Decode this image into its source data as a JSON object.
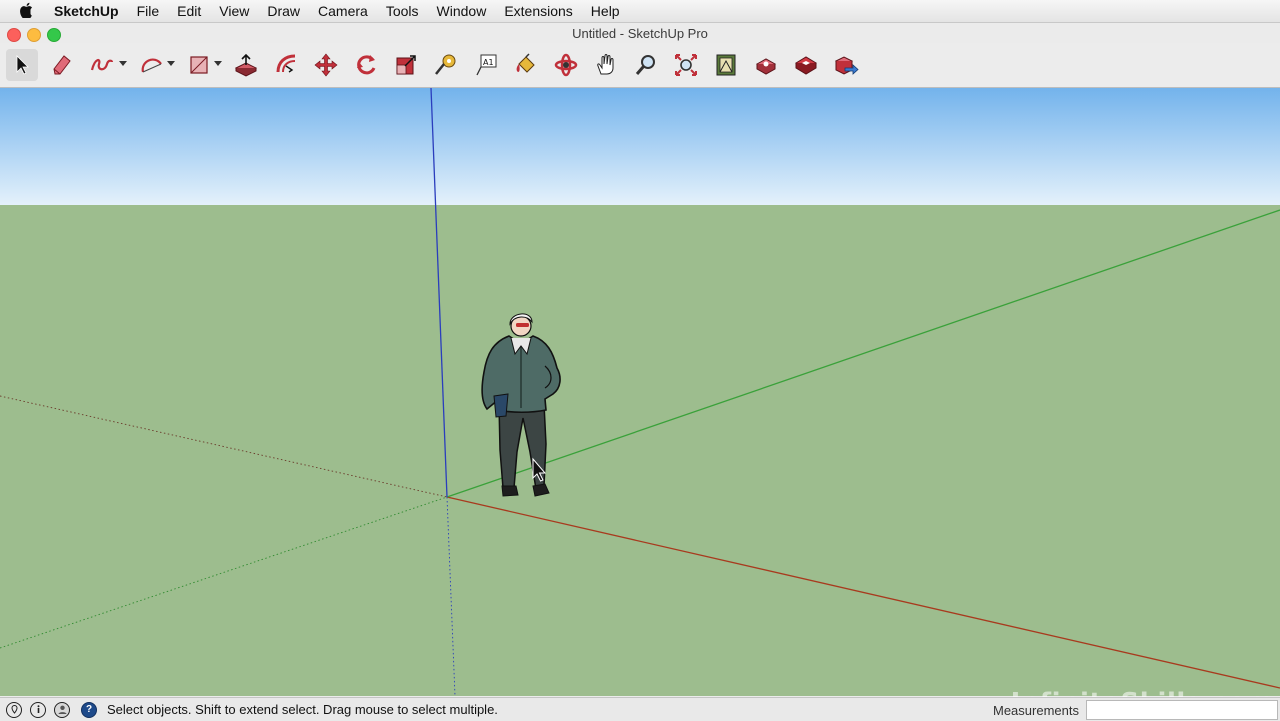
{
  "menubar": {
    "app_name": "SketchUp",
    "items": [
      "File",
      "Edit",
      "View",
      "Draw",
      "Camera",
      "Tools",
      "Window",
      "Extensions",
      "Help"
    ]
  },
  "window": {
    "title": "Untitled - SketchUp Pro"
  },
  "toolbar": {
    "tools": [
      {
        "name": "select-tool",
        "icon": "arrow-cursor-icon",
        "active": true
      },
      {
        "name": "eraser-tool",
        "icon": "eraser-icon"
      },
      {
        "name": "freehand-tool",
        "icon": "freehand-curve-icon",
        "dropdown": true
      },
      {
        "name": "arc-tool",
        "icon": "arc-icon",
        "dropdown": true
      },
      {
        "name": "rectangle-tool",
        "icon": "rectangle-icon",
        "dropdown": true
      },
      {
        "name": "push-pull-tool",
        "icon": "push-pull-icon"
      },
      {
        "name": "offset-tool",
        "icon": "offset-icon"
      },
      {
        "name": "move-tool",
        "icon": "move-arrows-icon"
      },
      {
        "name": "rotate-tool",
        "icon": "rotate-icon"
      },
      {
        "name": "scale-tool",
        "icon": "scale-icon"
      },
      {
        "name": "tape-measure-tool",
        "icon": "tape-measure-icon"
      },
      {
        "name": "text-tool",
        "icon": "text-icon"
      },
      {
        "name": "paint-bucket-tool",
        "icon": "paint-bucket-icon"
      },
      {
        "name": "orbit-tool",
        "icon": "orbit-icon"
      },
      {
        "name": "pan-tool",
        "icon": "hand-icon"
      },
      {
        "name": "zoom-tool",
        "icon": "magnifier-icon"
      },
      {
        "name": "zoom-extents-tool",
        "icon": "zoom-extents-icon"
      },
      {
        "name": "warehouse-tool",
        "icon": "warehouse-icon"
      },
      {
        "name": "extension-warehouse-tool",
        "icon": "extension-warehouse-icon"
      },
      {
        "name": "components-tool",
        "icon": "components-icon"
      },
      {
        "name": "share-model-tool",
        "icon": "share-model-icon"
      }
    ]
  },
  "status": {
    "message": "Select objects. Shift to extend select. Drag mouse to select multiple.",
    "measurements_label": "Measurements",
    "measurements_value": ""
  },
  "watermark": "InfiniteSkills.com",
  "colors": {
    "sky_top": "#73b3ec",
    "sky_bottom": "#e4f1fb",
    "ground": "#9dbd8e",
    "axis_red": "#a83a1e",
    "axis_green": "#3aa13a",
    "axis_blue": "#2a3dbd",
    "figure_jacket": "#4e6b66",
    "figure_pants": "#3c4544",
    "tool_red": "#c0303a"
  }
}
